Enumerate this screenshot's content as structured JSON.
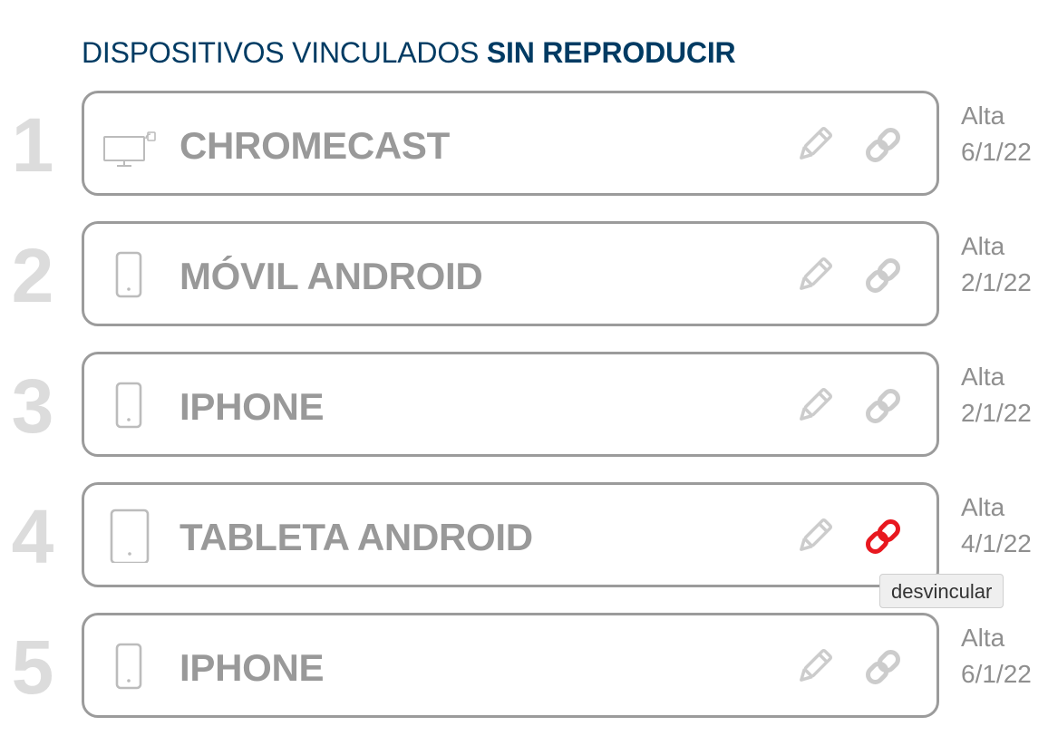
{
  "header": {
    "title_prefix": "DISPOSITIVOS VINCULADOS",
    "title_highlight": "SIN REPRODUCIR"
  },
  "colors": {
    "title": "#003b63",
    "card_border": "#9b9b9b",
    "device_text": "#999999",
    "index_number": "#dcdcdc",
    "action_icon": "#cccccc",
    "unlink_active": "#e8181f"
  },
  "devices": [
    {
      "index": "1",
      "icon": "tv-cast-icon",
      "name": "CHROMECAST",
      "alta_label": "Alta",
      "alta_date": "6/1/22",
      "unlink_active": false
    },
    {
      "index": "2",
      "icon": "smartphone-icon",
      "name": "MÓVIL ANDROID",
      "alta_label": "Alta",
      "alta_date": "2/1/22",
      "unlink_active": false
    },
    {
      "index": "3",
      "icon": "smartphone-icon",
      "name": "IPHONE",
      "alta_label": "Alta",
      "alta_date": "2/1/22",
      "unlink_active": false
    },
    {
      "index": "4",
      "icon": "tablet-icon",
      "name": "TABLETA ANDROID",
      "alta_label": "Alta",
      "alta_date": "4/1/22",
      "unlink_active": true
    },
    {
      "index": "5",
      "icon": "smartphone-icon",
      "name": "IPHONE",
      "alta_label": "Alta",
      "alta_date": "6/1/22",
      "unlink_active": false
    }
  ],
  "tooltip": {
    "text": "desvincular"
  }
}
